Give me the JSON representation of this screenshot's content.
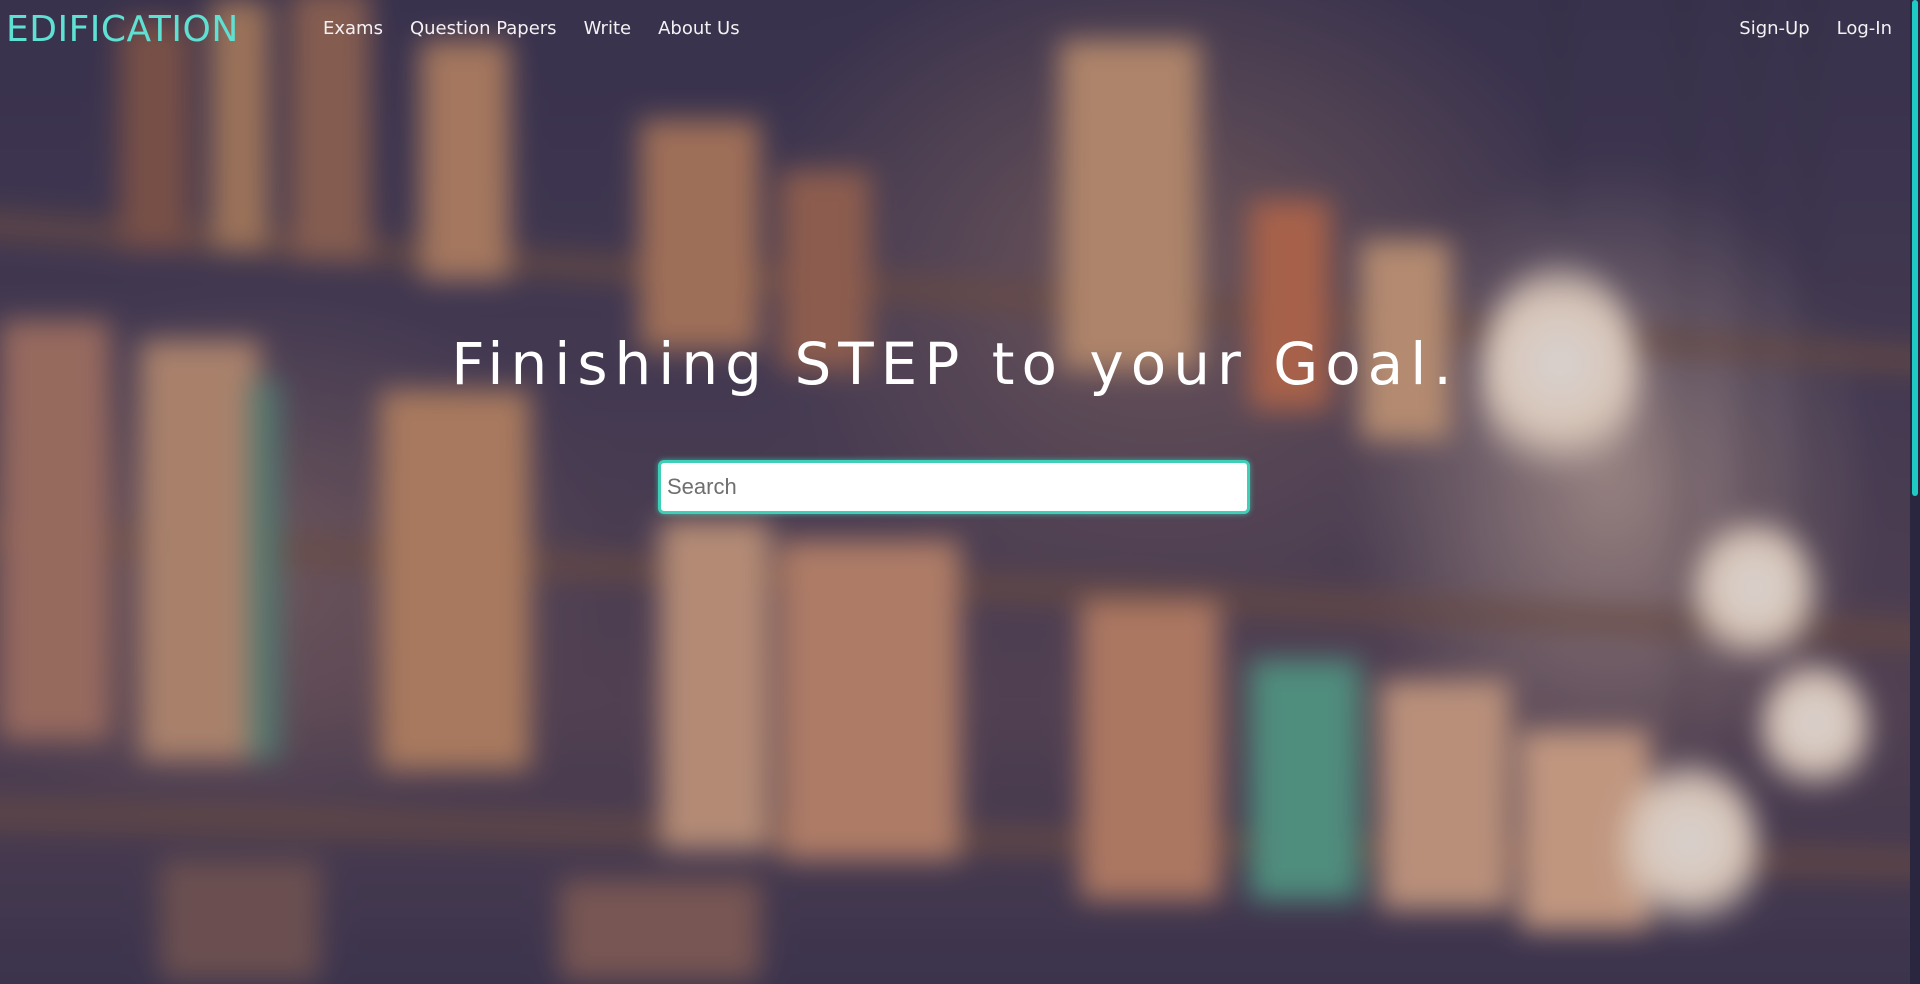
{
  "brand": {
    "name": "EDIFICATION"
  },
  "nav": {
    "left_links": [
      {
        "label": "Exams"
      },
      {
        "label": "Question Papers"
      },
      {
        "label": "Write"
      },
      {
        "label": "About Us"
      }
    ],
    "right_links": [
      {
        "label": "Sign-Up"
      },
      {
        "label": "Log-In"
      }
    ]
  },
  "hero": {
    "title": "Finishing STEP to your Goal.",
    "search": {
      "placeholder": "Search",
      "value": ""
    }
  },
  "colors": {
    "accent": "#5ee0d2",
    "search_border": "#3fcfb8",
    "scroll_thumb": "#1fc9c4"
  }
}
